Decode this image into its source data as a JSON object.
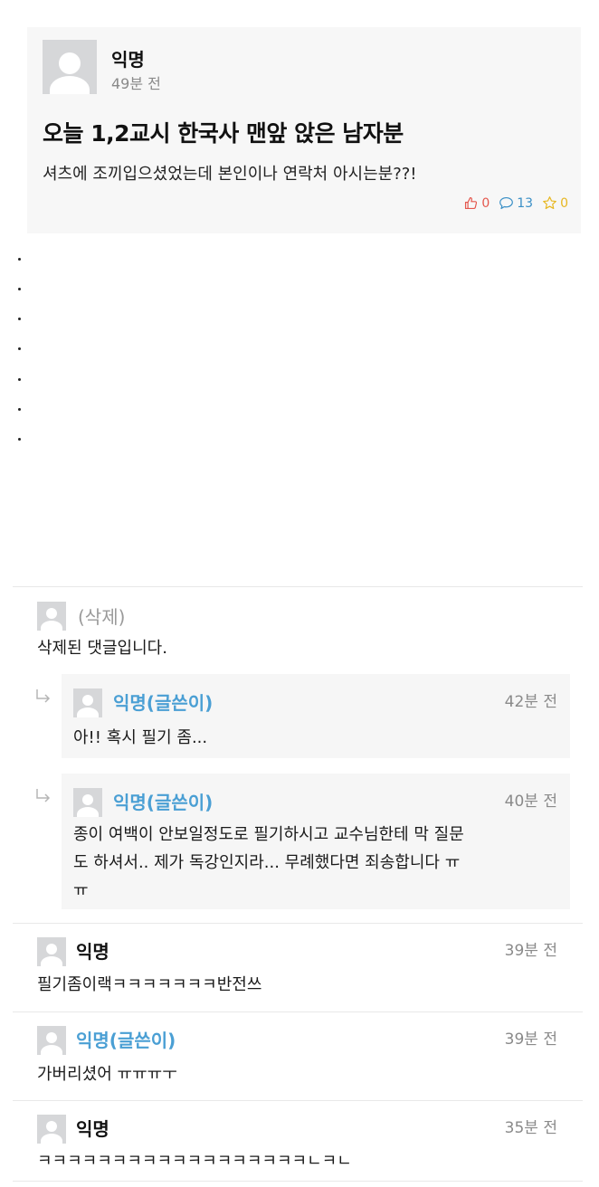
{
  "post": {
    "author": "익명",
    "time": "49분 전",
    "title": "오늘 1,2교시 한국사 맨앞 앉은 남자분",
    "content": "셔츠에 조끼입으셨었는데 본인이나 연락처 아시는분??!",
    "likes": "0",
    "comments": "13",
    "scraps": "0"
  },
  "dots": [
    ".",
    ".",
    ".",
    ".",
    ".",
    ".",
    "."
  ],
  "comments": [
    {
      "author": "(삭제)",
      "time": "",
      "text": "삭제된 댓글입니다."
    },
    {
      "author": "익명(글쓴이)",
      "time": "42분 전",
      "text": "아!! 혹시 필기 좀...",
      "reply": true
    },
    {
      "author": "익명(글쓴이)",
      "time": "40분 전",
      "text_lines": [
        "종이 여백이 안보일정도로 필기하시고 교수님한테 막 질문",
        "도 하셔서.. 제가 독강인지라... 무례했다면 죄송합니다 ㅠ",
        "ㅠ"
      ],
      "reply": true
    },
    {
      "author": "익명",
      "time": "39분 전",
      "text": "필기좀이랙ㅋㅋㅋㅋㅋㅋㅋ반전쓰"
    },
    {
      "author": "익명(글쓴이)",
      "time": "39분 전",
      "text": "가버리셨어 ㅠㅠㅠㅜ"
    },
    {
      "author": "익명",
      "time": "35분 전",
      "text": "ㅋㅋㅋㅋㅋㅋㅋㅋㅋㅋㅋㅋㅋㅋㅋㅋㅋㅋㄴㅋㄴ"
    }
  ],
  "colors": {
    "writer": "#4a9fd4",
    "like": "#e4574d",
    "comment": "#3a8fc6",
    "scrap": "#e7b721"
  },
  "icons": {
    "like": "thumbs-up-icon",
    "comment": "speech-bubble-icon",
    "scrap": "star-icon",
    "reply": "reply-arrow-icon",
    "avatar": "default-avatar-icon"
  }
}
